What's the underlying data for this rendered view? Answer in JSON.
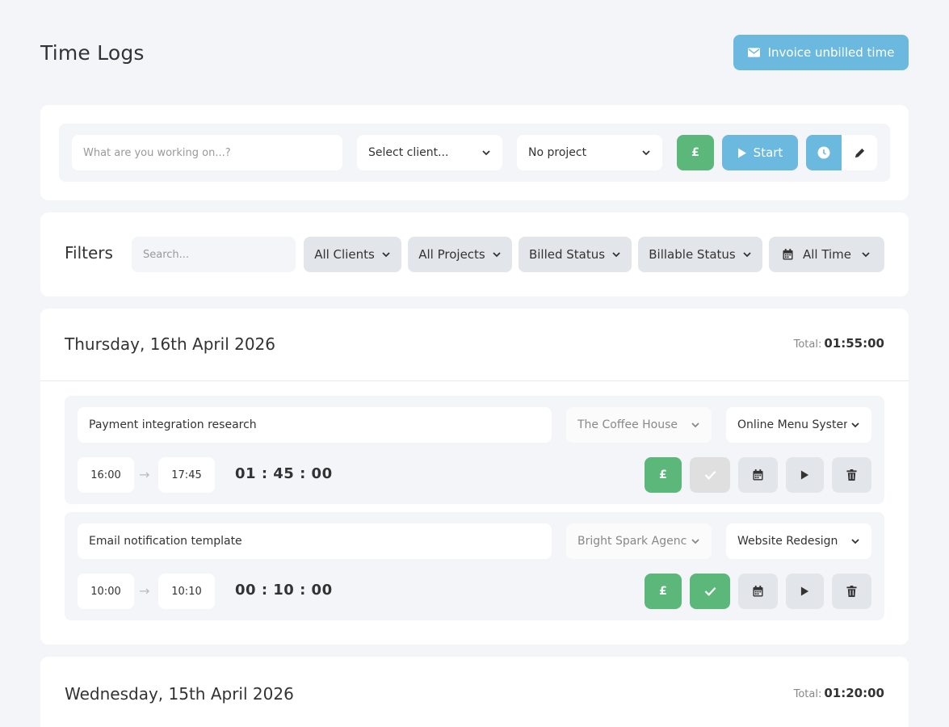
{
  "header": {
    "title": "Time Logs",
    "invoice_button": "Invoice unbilled time"
  },
  "timer": {
    "description_placeholder": "What are you working on...?",
    "client_select": "Select client...",
    "project_select": "No project",
    "billable_symbol": "£",
    "start_label": "Start"
  },
  "filters": {
    "label": "Filters",
    "search_placeholder": "Search...",
    "clients": "All Clients",
    "projects": "All Projects",
    "billed_status": "Billed Status",
    "billable_status": "Billable Status",
    "time_range": "All Time"
  },
  "days": [
    {
      "date": "Thursday, 16th April 2026",
      "total_label": "Total:",
      "total": "01:55:00",
      "entries": [
        {
          "description": "Payment integration research",
          "client": "The Coffee House",
          "project": "Online Menu System",
          "start": "16:00",
          "end": "17:45",
          "arrow": "→",
          "duration": "01 : 45 : 00",
          "billable_symbol": "£",
          "billed": false
        },
        {
          "description": "Email notification template",
          "client": "Bright Spark Agency",
          "project": "Website Redesign",
          "start": "10:00",
          "end": "10:10",
          "arrow": "→",
          "duration": "00 : 10 : 00",
          "billable_symbol": "£",
          "billed": true
        }
      ]
    },
    {
      "date": "Wednesday, 15th April 2026",
      "total_label": "Total:",
      "total": "01:20:00"
    }
  ],
  "colors": {
    "accent_blue": "#6bb9de",
    "billable_green": "#5cb87a",
    "background": "#f4f5f9"
  }
}
